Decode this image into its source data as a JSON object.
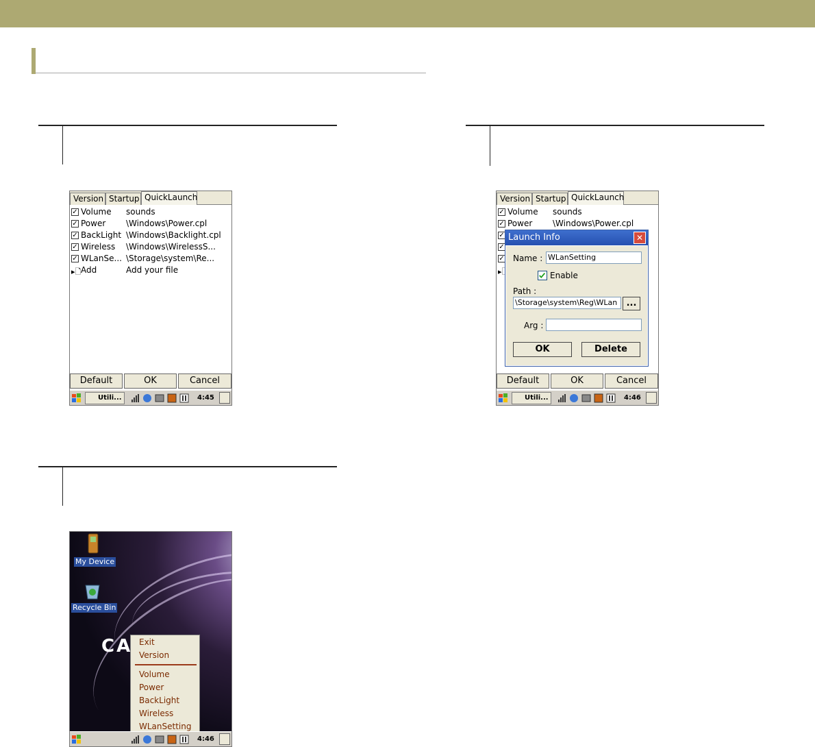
{
  "colors": {
    "accent": "#ada972"
  },
  "screen_left": {
    "tabs": [
      "Version",
      "Startup",
      "QuickLaunch"
    ],
    "items": [
      {
        "name": "Volume",
        "path": "sounds"
      },
      {
        "name": "Power",
        "path": "\\Windows\\Power.cpl"
      },
      {
        "name": "BackLight",
        "path": "\\Windows\\Backlight.cpl"
      },
      {
        "name": "Wireless",
        "path": "\\Windows\\WirelessS..."
      },
      {
        "name": "WLanSe...",
        "path": "\\Storage\\system\\Re..."
      }
    ],
    "add": {
      "name": "Add",
      "path": "Add your file"
    },
    "buttons": {
      "default": "Default",
      "ok": "OK",
      "cancel": "Cancel"
    },
    "taskbar": {
      "app": "Utili...",
      "clock": "4:45"
    }
  },
  "screen_right": {
    "tabs": [
      "Version",
      "Startup",
      "QuickLaunch"
    ],
    "items": [
      {
        "name": "Volume",
        "path": "sounds"
      },
      {
        "name": "Power",
        "path": "\\Windows\\Power.cpl"
      }
    ],
    "buttons": {
      "default": "Default",
      "ok": "OK",
      "cancel": "Cancel"
    },
    "taskbar": {
      "app": "Utili...",
      "clock": "4:46"
    },
    "dialog": {
      "title": "Launch Info",
      "name_label": "Name :",
      "name_value": "WLanSetting",
      "enable_label": "Enable",
      "path_label": "Path :",
      "path_value": "\\Storage\\system\\Reg\\WLan",
      "browse_label": "...",
      "arg_label": "Arg :",
      "arg_value": "",
      "ok_label": "OK",
      "delete_label": "Delete"
    }
  },
  "screen_desktop": {
    "icons": {
      "my_device": "My Device",
      "recycle_bin": "Recycle Bin"
    },
    "logo_text": "CA   LL",
    "menu": [
      "Exit",
      "Version",
      "Volume",
      "Power",
      "BackLight",
      "Wireless",
      "WLanSetting"
    ],
    "taskbar": {
      "clock": "4:46"
    }
  }
}
